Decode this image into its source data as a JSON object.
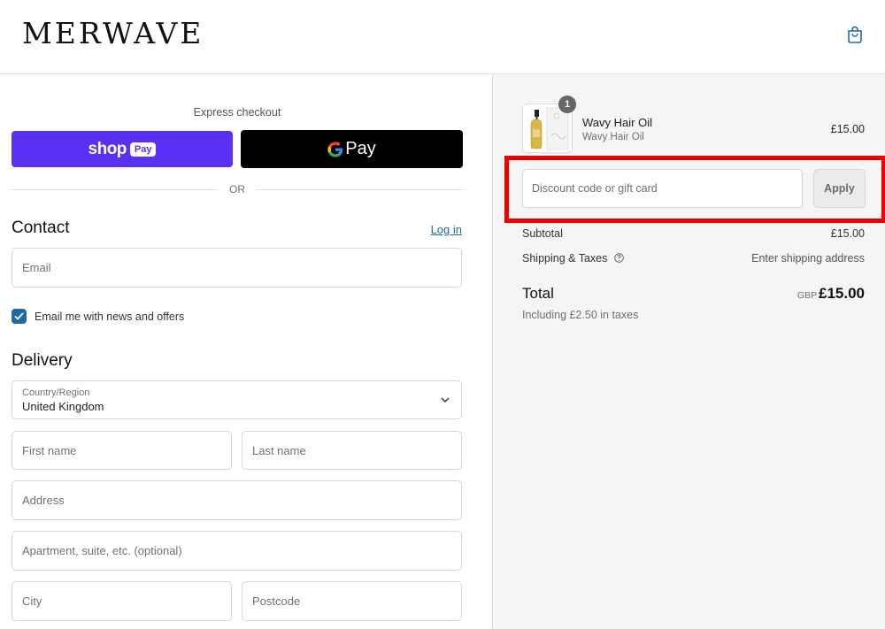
{
  "header": {
    "logo": "MERWAVE",
    "cart_icon": "shopping-bag-icon"
  },
  "express": {
    "label": "Express checkout",
    "shop_pay": {
      "word": "shop",
      "badge": "Pay",
      "color": "#5a31f4"
    },
    "google_pay": {
      "word": "Pay",
      "color": "#000000"
    },
    "divider_label": "OR"
  },
  "contact": {
    "title": "Contact",
    "login_link": "Log in",
    "email_placeholder": "Email",
    "newsletter_label": "Email me with news and offers",
    "newsletter_checked": true
  },
  "delivery": {
    "title": "Delivery",
    "country_label": "Country/Region",
    "country_value": "United Kingdom",
    "first_name_placeholder": "First name",
    "last_name_placeholder": "Last name",
    "address_placeholder": "Address",
    "apartment_placeholder": "Apartment, suite, etc. (optional)",
    "city_placeholder": "City",
    "postcode_placeholder": "Postcode"
  },
  "summary": {
    "product": {
      "name": "Wavy Hair Oil",
      "variant": "Wavy Hair Oil",
      "price": "£15.00",
      "quantity": "1"
    },
    "discount": {
      "placeholder": "Discount code or gift card",
      "apply_label": "Apply",
      "highlight_color": "#ef0000"
    },
    "subtotal_label": "Subtotal",
    "subtotal_value": "£15.00",
    "shipping_label": "Shipping & Taxes",
    "shipping_value": "Enter shipping address",
    "total_label": "Total",
    "total_currency": "GBP",
    "total_value": "£15.00",
    "taxes_note": "Including £2.50 in taxes"
  },
  "colors": {
    "accent": "#1f6aa5",
    "sidebar_bg": "#f5f5f5"
  }
}
